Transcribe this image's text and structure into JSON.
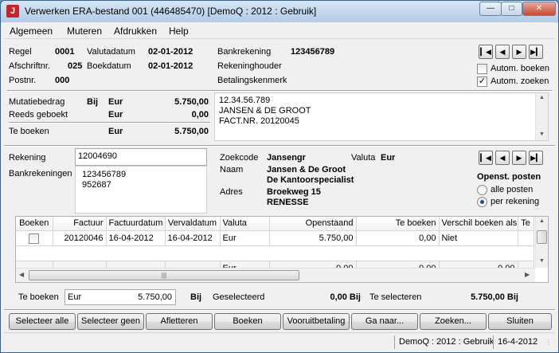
{
  "window": {
    "title": "Verwerken ERA-bestand 001 (446485470)  [DemoQ : 2012 : Gebruik]",
    "icon_letter": "J",
    "controls": [
      "minimize-icon",
      "maximize-icon",
      "close-icon"
    ]
  },
  "menu": [
    "Algemeen",
    "Muteren",
    "Afdrukken",
    "Help"
  ],
  "header": {
    "regel_label": "Regel",
    "regel_value": "0001",
    "valutadatum_label": "Valutadatum",
    "valutadatum_value": "02-01-2012",
    "afschrift_label": "Afschriftnr.",
    "afschrift_value": "025",
    "boekdatum_label": "Boekdatum",
    "boekdatum_value": "02-01-2012",
    "postnr_label": "Postnr.",
    "postnr_value": "000",
    "bankrekening_label": "Bankrekening",
    "bankrekening_value": "123456789",
    "rekeninghouder_label": "Rekeninghouder",
    "betalingskenmerk_label": "Betalingskenmerk",
    "autom_boeken_label": "Autom. boeken",
    "autom_boeken_checked": false,
    "autom_zoeken_label": "Autom. zoeken",
    "autom_zoeken_checked": true
  },
  "amounts": {
    "mutatiebedrag_label": "Mutatiebedrag",
    "mutatiebedrag_dir": "Bij",
    "mutatiebedrag_cur": "Eur",
    "mutatiebedrag_value": "5.750,00",
    "reeds_label": "Reeds geboekt",
    "reeds_cur": "Eur",
    "reeds_value": "0,00",
    "teboeken_label": "Te boeken",
    "teboeken_cur": "Eur",
    "teboeken_value": "5.750,00"
  },
  "description_lines": [
    "12.34.56.789",
    "JANSEN & DE GROOT",
    "FACT.NR. 20120045"
  ],
  "relation": {
    "rekening_label": "Rekening",
    "rekening_value": "12004690",
    "bankrekeningen_label": "Bankrekeningen",
    "bankrekeningen": [
      "123456789",
      "952687"
    ],
    "zoekcode_label": "Zoekcode",
    "zoekcode_value": "Jansengr",
    "valuta_label": "Valuta",
    "valuta_value": "Eur",
    "naam_label": "Naam",
    "naam_line1": "Jansen & De Groot",
    "naam_line2": "De Kantoorspecialist",
    "adres_label": "Adres",
    "adres_line1": "Broekweg 15",
    "adres_line2": "RENESSE",
    "openst_label": "Openst. posten",
    "radio_alle": "alle posten",
    "radio_per": "per rekening",
    "selected_radio": "per rekening"
  },
  "grid": {
    "columns": [
      "Boeken",
      "Factuur",
      "Factuurdatum",
      "Vervaldatum",
      "Valuta",
      "Openstaand",
      "Te boeken",
      "Verschil boeken als",
      "Te"
    ],
    "rows": [
      {
        "boeken": false,
        "factuur": "20120046",
        "factuurdatum": "16-04-2012",
        "vervaldatum": "16-04-2012",
        "valuta": "Eur",
        "openstaand": "5.750,00",
        "teboeken": "0,00",
        "verschil": "Niet"
      }
    ],
    "totals": {
      "valuta": "Eur",
      "openstaand": "0,00",
      "teboeken": "0,00",
      "verschil": "0,00"
    }
  },
  "footer": {
    "teboeken_label": "Te boeken",
    "teboeken_cur": "Eur",
    "teboeken_value": "5.750,00",
    "teboeken_dir": "Bij",
    "geselecteerd_label": "Geselecteerd",
    "geselecteerd_value": "0,00 Bij",
    "teselecteren_label": "Te selecteren",
    "teselecteren_value": "5.750,00 Bij"
  },
  "buttons": [
    "Selecteer alle",
    "Selecteer geen",
    "Afletteren",
    "Boeken",
    "Vooruitbetaling",
    "Ga naar...",
    "Zoeken...",
    "Sluiten"
  ],
  "status": {
    "context": "DemoQ : 2012 : Gebruik",
    "date": "16-4-2012"
  }
}
